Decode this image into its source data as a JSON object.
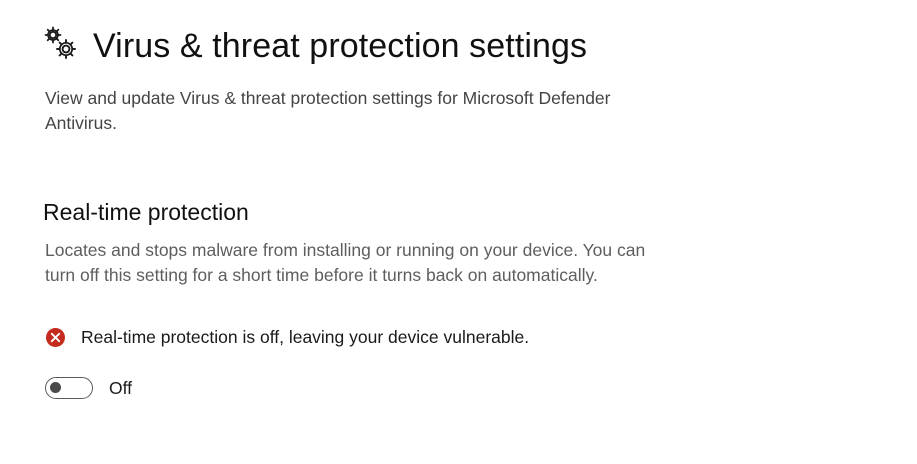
{
  "header": {
    "icon": "gear-cog-icon",
    "title": "Virus & threat protection settings",
    "description": "View and update Virus & threat protection settings for Microsoft Defender Antivirus."
  },
  "realtime": {
    "title": "Real-time protection",
    "description": "Locates and stops malware from installing or running on your device. You can turn off this setting for a short time before it turns back on automatically.",
    "status_icon": "error-icon",
    "status_text": "Real-time protection is off, leaving your device vulnerable.",
    "toggle_state": "Off",
    "toggle_on": false
  },
  "colors": {
    "error": "#C42B1C",
    "toggle_off_border": "#5A5A5A",
    "text_secondary": "#5E5E5E"
  }
}
